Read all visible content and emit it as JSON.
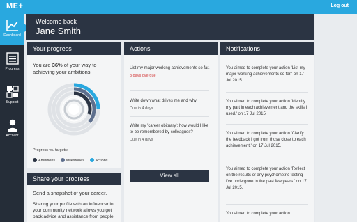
{
  "app": {
    "logo": "ME+",
    "logout_label": "Log out"
  },
  "sidebar": {
    "items": [
      {
        "label": "Dashboard",
        "icon": "chart-line-icon",
        "active": true
      },
      {
        "label": "Progress",
        "icon": "list-icon",
        "active": false
      },
      {
        "label": "Support",
        "icon": "puzzle-icon",
        "active": false
      },
      {
        "label": "Account",
        "icon": "user-icon",
        "active": false
      }
    ]
  },
  "welcome": {
    "subtitle": "Welcome back",
    "name": "Jane Smith"
  },
  "progress": {
    "title": "Your progress",
    "text_pre": "You are ",
    "percent_text": "36%",
    "text_post": " of your way to achieving your ambitions!",
    "percent": 36,
    "targets_label": "Progress vs. targets:",
    "rings": [
      {
        "name": "Ambitions",
        "color": "#2b3443",
        "fraction": 0.3
      },
      {
        "name": "Milestones",
        "color": "#5e6f8d",
        "fraction": 0.36
      },
      {
        "name": "Actions",
        "color": "#29a8df",
        "fraction": 0.25
      }
    ]
  },
  "share": {
    "title": "Share your progress",
    "line": "Send a snapshot of your career.",
    "body": "Sharing your profile with an influencer in your community network allows you get back advice and assistance from people"
  },
  "actions": {
    "title": "Actions",
    "items": [
      {
        "text": "List my major working achievements so far.",
        "due": "3 days overdue",
        "overdue": true
      },
      {
        "text": "Write down what drives me and why.",
        "due": "Due in 4 days",
        "overdue": false
      },
      {
        "text": "Write my 'career obituary': how would I like to be remembered by colleagues?",
        "due": "Due in 4 days",
        "overdue": false
      }
    ],
    "view_all_label": "View all"
  },
  "notifications": {
    "title": "Notifications",
    "items": [
      "You aimed to complete your action 'List my major working achievements so far.' on 17 Jul 2015.",
      "You aimed to complete your action 'Identify my part in each achievement and the skills I used.' on 17 Jul 2015.",
      "You aimed to complete your action 'Clarify the feedback I got from those close to each achievement.' on 17 Jul 2015.",
      "You aimed to complete your action 'Reflect on the results of any psychometric testing I've undergone in the past few years.' on 17 Jul 2015.",
      "You aimed to complete your action"
    ]
  },
  "colors": {
    "accent": "#29a8df",
    "dark": "#2b3443",
    "overdue": "#d33b3b"
  }
}
